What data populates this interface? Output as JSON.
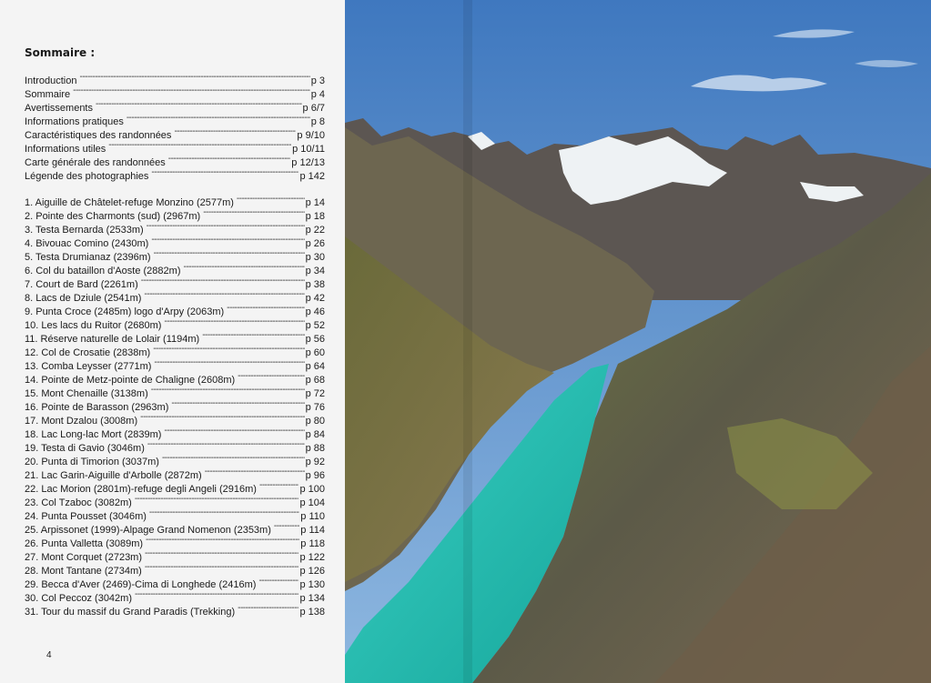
{
  "left_page": {
    "title": "Sommaire :",
    "general_entries": [
      {
        "label": "Introduction",
        "page": "p 3"
      },
      {
        "label": "Sommaire",
        "page": "p 4"
      },
      {
        "label": "Avertissements",
        "page": "p 6/7"
      },
      {
        "label": "Informations pratiques",
        "page": "p 8"
      },
      {
        "label": "Caractéristiques des randonnées",
        "page": "p 9/10"
      },
      {
        "label": "Informations utiles",
        "page": "p 10/11"
      },
      {
        "label": "Carte générale des randonnées",
        "page": "p 12/13"
      },
      {
        "label": "Légende des photographies",
        "page": "p 142"
      }
    ],
    "hikes": [
      {
        "label": "1.  Aiguille de Châtelet-refuge Monzino (2577m)",
        "page": "p 14"
      },
      {
        "label": "2.  Pointe des Charmonts (sud) (2967m)",
        "page": "p 18"
      },
      {
        "label": "3.  Testa Bernarda (2533m)",
        "page": "p 22"
      },
      {
        "label": "4.  Bivouac Comino (2430m)",
        "page": "p 26"
      },
      {
        "label": "5.  Testa Drumianaz (2396m)",
        "page": "p 30"
      },
      {
        "label": "6.  Col du bataillon d'Aoste (2882m)",
        "page": "p 34"
      },
      {
        "label": "7.  Court de Bard (2261m)",
        "page": "p 38"
      },
      {
        "label": "8.  Lacs de Dziule (2541m)",
        "page": "p 42"
      },
      {
        "label": "9.  Punta Croce (2485m) logo d'Arpy (2063m)",
        "page": "p 46"
      },
      {
        "label": "10. Les lacs du Ruitor (2680m)",
        "page": "p 52"
      },
      {
        "label": "11. Réserve naturelle de Lolair (1194m)",
        "page": "p 56"
      },
      {
        "label": "12. Col de Crosatie (2838m)",
        "page": "p 60"
      },
      {
        "label": "13. Comba Leysser (2771m)",
        "page": "p 64"
      },
      {
        "label": "14. Pointe de Metz-pointe de Chaligne (2608m)",
        "page": "p 68"
      },
      {
        "label": "15. Mont Chenaille (3138m)",
        "page": "p 72"
      },
      {
        "label": "16. Pointe de Barasson (2963m)",
        "page": "p 76"
      },
      {
        "label": "17. Mont Dzalou (3008m)",
        "page": "p 80"
      },
      {
        "label": "18. Lac Long-lac Mort (2839m)",
        "page": "p 84"
      },
      {
        "label": "19. Testa di Gavio (3046m)",
        "page": "p 88"
      },
      {
        "label": "20. Punta di Timorion (3037m)",
        "page": "p 92"
      },
      {
        "label": "21. Lac Garin-Aiguille d'Arbolle (2872m)",
        "page": "p 96"
      },
      {
        "label": "22. Lac Morion (2801m)-refuge degli Angeli (2916m)",
        "page": "p 100"
      },
      {
        "label": "23. Col Tzaboc (3082m)",
        "page": "p 104"
      },
      {
        "label": "24. Punta Pousset (3046m)",
        "page": "p 110"
      },
      {
        "label": "25. Arpissonet (1999)-Alpage Grand Nomenon (2353m)",
        "page": "p 114"
      },
      {
        "label": "26. Punta Valletta (3089m)",
        "page": "p 118"
      },
      {
        "label": "27. Mont Corquet (2723m)",
        "page": "p 122"
      },
      {
        "label": "28. Mont Tantane (2734m)",
        "page": "p 126"
      },
      {
        "label": "29. Becca d'Aver (2469)-Cima di Longhede (2416m)",
        "page": "p 130"
      },
      {
        "label": "30. Col Peccoz (3042m)",
        "page": "p 134"
      },
      {
        "label": "31. Tour du massif du Grand Paradis (Trekking)",
        "page": "p 138"
      }
    ],
    "page_number": "4"
  },
  "right_page": {
    "photo": "alpine-valley-turquoise-lake",
    "colors": {
      "sky": "#4f86c6",
      "lake": "#2ec4b8",
      "snow": "#eef2f4",
      "rock": "#5a5450",
      "grass": "#7a8a3a"
    }
  }
}
